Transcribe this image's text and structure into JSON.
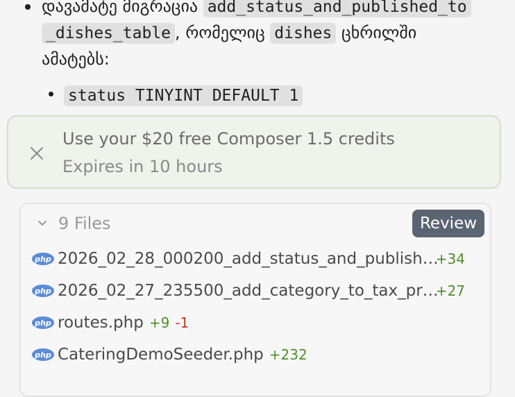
{
  "chat": {
    "line1_text": "დავამატე მიგრაცია ",
    "line1_code": "add_status_and_published_to",
    "line2_code": "_dishes_table",
    "line2_mid": ", რომელიც ",
    "line2_code2": "dishes",
    "line2_tail": " ცხრილში",
    "line3_text": "ამატებს:",
    "sub_bullet_code": "status TINYINT DEFAULT 1"
  },
  "banner": {
    "title": "Use your $20 free Composer 1.5 credits",
    "subtitle": "Expires in 10 hours"
  },
  "files_panel": {
    "count_label": "9 Files",
    "review_label": "Review",
    "files": [
      {
        "badge": "php",
        "name": "2026_02_28_000200_add_status_and_publish…",
        "added": "+34",
        "removed": ""
      },
      {
        "badge": "php",
        "name": "2026_02_27_235500_add_category_to_tax_pr…",
        "added": "+27",
        "removed": ""
      },
      {
        "badge": "php",
        "name": "routes.php",
        "added": "+9",
        "removed": "-1"
      },
      {
        "badge": "php",
        "name": "CateringDemoSeeder.php",
        "added": "+232",
        "removed": ""
      }
    ]
  }
}
